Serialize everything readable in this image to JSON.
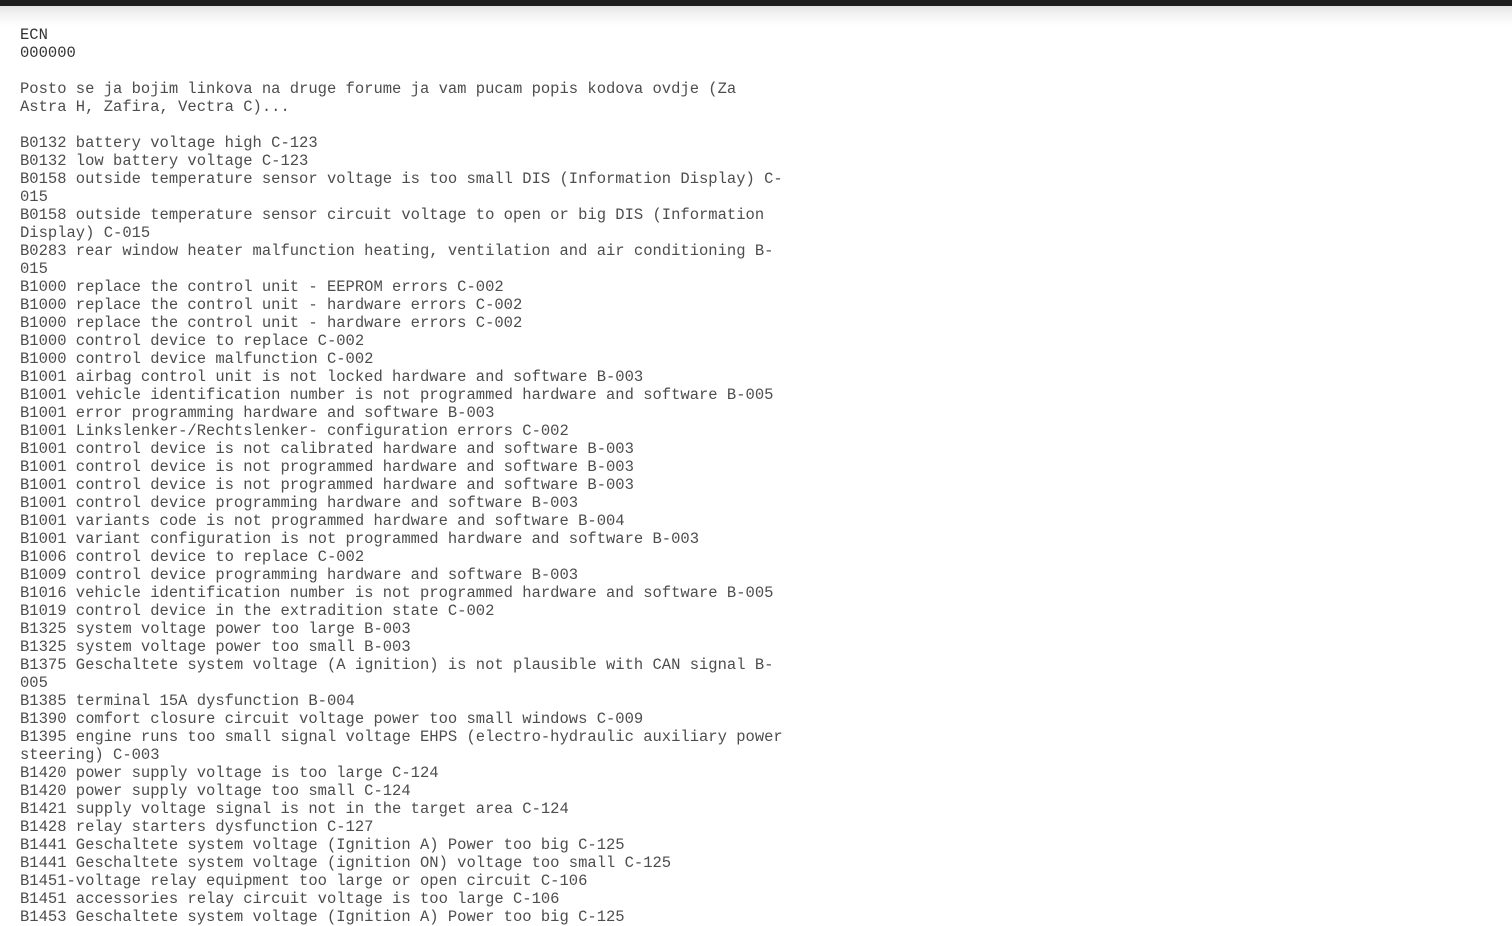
{
  "document": {
    "heading": "ECN",
    "subheading": "000000",
    "intro": "Posto se ja bojim linkova na druge forume ja vam pucam popis kodova ovdje (Za Astra H, Zafira, Vectra C)...",
    "code_lines": [
      "B0132 battery voltage high C-123",
      "B0132 low battery voltage C-123",
      "B0158 outside temperature sensor voltage is too small DIS (Information Display) C-015",
      "B0158 outside temperature sensor circuit voltage to open or big DIS (Information Display) C-015",
      "B0283 rear window heater malfunction heating, ventilation and air conditioning B-015",
      "B1000 replace the control unit - EEPROM errors C-002",
      "B1000 replace the control unit - hardware errors C-002",
      "B1000 replace the control unit - hardware errors C-002",
      "B1000 control device to replace C-002",
      "B1000 control device malfunction C-002",
      "B1001 airbag control unit is not locked hardware and software B-003",
      "B1001 vehicle identification number is not programmed hardware and software B-005",
      "B1001 error programming hardware and software B-003",
      "B1001 Linkslenker-/Rechtslenker- configuration errors C-002",
      "B1001 control device is not calibrated hardware and software B-003",
      "B1001 control device is not programmed hardware and software B-003",
      "B1001 control device is not programmed hardware and software B-003",
      "B1001 control device programming hardware and software B-003",
      "B1001 variants code is not programmed hardware and software B-004",
      "B1001 variant configuration is not programmed hardware and software B-003",
      "B1006 control device to replace C-002",
      "B1009 control device programming hardware and software B-003",
      "B1016 vehicle identification number is not programmed hardware and software B-005",
      "B1019 control device in the extradition state C-002",
      "B1325 system voltage power too large B-003",
      "B1325 system voltage power too small B-003",
      "B1375 Geschaltete system voltage (A ignition) is not plausible with CAN signal B-005",
      "B1385 terminal 15A dysfunction B-004",
      "B1390 comfort closure circuit voltage power too small windows C-009",
      "B1395 engine runs too small signal voltage EHPS (electro-hydraulic auxiliary power steering) C-003",
      "B1420 power supply voltage is too large C-124",
      "B1420 power supply voltage too small C-124",
      "B1421 supply voltage signal is not in the target area C-124",
      "B1428 relay starters dysfunction C-127",
      "B1441 Geschaltete system voltage (Ignition A) Power too big C-125",
      "B1441 Geschaltete system voltage (ignition ON) voltage too small C-125",
      "B1451-voltage relay equipment too large or open circuit C-106",
      "B1451 accessories relay circuit voltage is too large C-106",
      "B1453 Geschaltete system voltage (Ignition A) Power too big C-125"
    ]
  },
  "colors": {
    "top_bar": "#1f1f1f",
    "text": "#4d4d4d",
    "heading_text": "#333333",
    "background": "#ffffff"
  }
}
